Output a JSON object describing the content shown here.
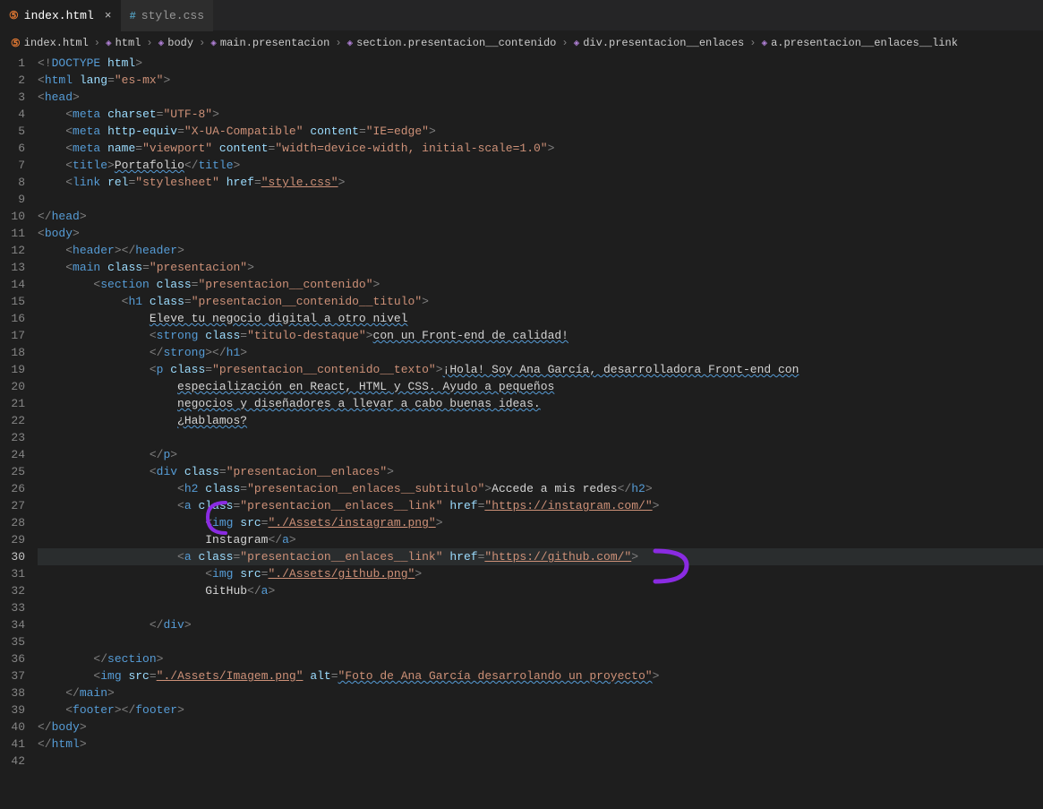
{
  "tabs": [
    {
      "label": "index.html",
      "active": true,
      "iconType": "html"
    },
    {
      "label": "style.css",
      "active": false,
      "iconType": "css"
    }
  ],
  "breadcrumbs": [
    {
      "label": "index.html",
      "icon": "html"
    },
    {
      "label": "html",
      "icon": "cube"
    },
    {
      "label": "body",
      "icon": "cube"
    },
    {
      "label": "main.presentacion",
      "icon": "cube"
    },
    {
      "label": "section.presentacion__contenido",
      "icon": "cube"
    },
    {
      "label": "div.presentacion__enlaces",
      "icon": "cube"
    },
    {
      "label": "a.presentacion__enlaces__link",
      "icon": "cube"
    }
  ],
  "lineCount": 42,
  "highlightedLine": 30,
  "code": {
    "l1_doctype": "DOCTYPE",
    "l1_html": "html",
    "l2_tag": "html",
    "l2_attr": "lang",
    "l2_val": "\"es-mx\"",
    "l3_tag": "head",
    "l4_tag": "meta",
    "l4_attr": "charset",
    "l4_val": "\"UTF-8\"",
    "l5_tag": "meta",
    "l5_attr1": "http-equiv",
    "l5_val1": "\"X-UA-Compatible\"",
    "l5_attr2": "content",
    "l5_val2": "\"IE=edge\"",
    "l6_tag": "meta",
    "l6_attr1": "name",
    "l6_val1": "\"viewport\"",
    "l6_attr2": "content",
    "l6_val2": "\"width=device-width, initial-scale=1.0\"",
    "l7_tag": "title",
    "l7_text": "Portafolio",
    "l8_tag": "link",
    "l8_attr1": "rel",
    "l8_val1": "\"stylesheet\"",
    "l8_attr2": "href",
    "l8_val2": "\"style.css\"",
    "l10_ctag": "head",
    "l11_tag": "body",
    "l12_tag": "header",
    "l13_tag": "main",
    "l13_attr": "class",
    "l13_val": "\"presentacion\"",
    "l14_tag": "section",
    "l14_attr": "class",
    "l14_val": "\"presentacion__contenido\"",
    "l15_tag": "h1",
    "l15_attr": "class",
    "l15_val": "\"presentacion__contenido__titulo\"",
    "l16_text": "Eleve tu negocio digital a otro nivel",
    "l17_tag": "strong",
    "l17_attr": "class",
    "l17_val": "\"titulo-destaque\"",
    "l17_text": "con un Front-end de calidad!",
    "l18_ctag1": "strong",
    "l18_ctag2": "h1",
    "l19_tag": "p",
    "l19_attr": "class",
    "l19_val": "\"presentacion__contenido__texto\"",
    "l19_text": "¡Hola! Soy Ana García, desarrolladora Front-end con",
    "l20_text": "especialización en React, HTML y CSS. Ayudo a pequeños",
    "l21_text": "negocios y diseñadores a llevar a cabo buenas ideas.",
    "l22_text": "¿Hablamos?",
    "l24_ctag": "p",
    "l25_tag": "div",
    "l25_attr": "class",
    "l25_val": "\"presentacion__enlaces\"",
    "l26_tag": "h2",
    "l26_attr": "class",
    "l26_val": "\"presentacion__enlaces__subtitulo\"",
    "l26_text": "Accede a mis redes",
    "l27_tag": "a",
    "l27_attr1": "class",
    "l27_val1": "\"presentacion__enlaces__link\"",
    "l27_attr2": "href",
    "l27_val2": "\"https://instagram.com/\"",
    "l28_tag": "img",
    "l28_attr": "src",
    "l28_val": "\"./Assets/instagram.png\"",
    "l29_text": "Instagram",
    "l29_ctag": "a",
    "l30_tag": "a",
    "l30_attr1": "class",
    "l30_val1": "\"presentacion__enlaces__link\"",
    "l30_attr2": "href",
    "l30_val2": "\"https://github.com/\"",
    "l31_tag": "img",
    "l31_attr": "src",
    "l31_val": "\"./Assets/github.png\"",
    "l32_text": "GitHub",
    "l32_ctag": "a",
    "l34_ctag": "div",
    "l36_ctag": "section",
    "l37_tag": "img",
    "l37_attr1": "src",
    "l37_val1": "\"./Assets/Imagem.png\"",
    "l37_attr2": "alt",
    "l37_val2": "\"Foto de Ana García desarrolando un proyecto\"",
    "l38_ctag": "main",
    "l39_tag": "footer",
    "l40_ctag": "body",
    "l41_ctag": "html"
  }
}
